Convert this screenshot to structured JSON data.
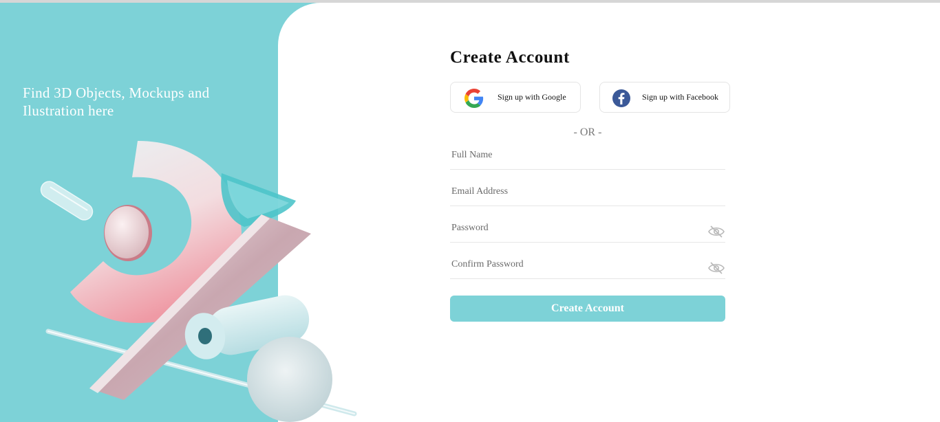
{
  "hero": {
    "tagline": "Find 3D Objects, Mockups and Ilustration here"
  },
  "form": {
    "title": "Create Account",
    "google_label": "Sign up with Google",
    "facebook_label": "Sign up with Facebook",
    "separator": "- OR -",
    "full_name_placeholder": "Full Name",
    "email_placeholder": "Email Address",
    "password_placeholder": "Password",
    "confirm_password_placeholder": "Confirm Password",
    "submit_label": "Create Account"
  },
  "icons": {
    "google": "google-logo-icon",
    "facebook": "facebook-logo-icon",
    "password_toggle": "eye-slash-icon"
  },
  "colors": {
    "accent": "#7dd2d7",
    "facebook": "#3b5998"
  }
}
